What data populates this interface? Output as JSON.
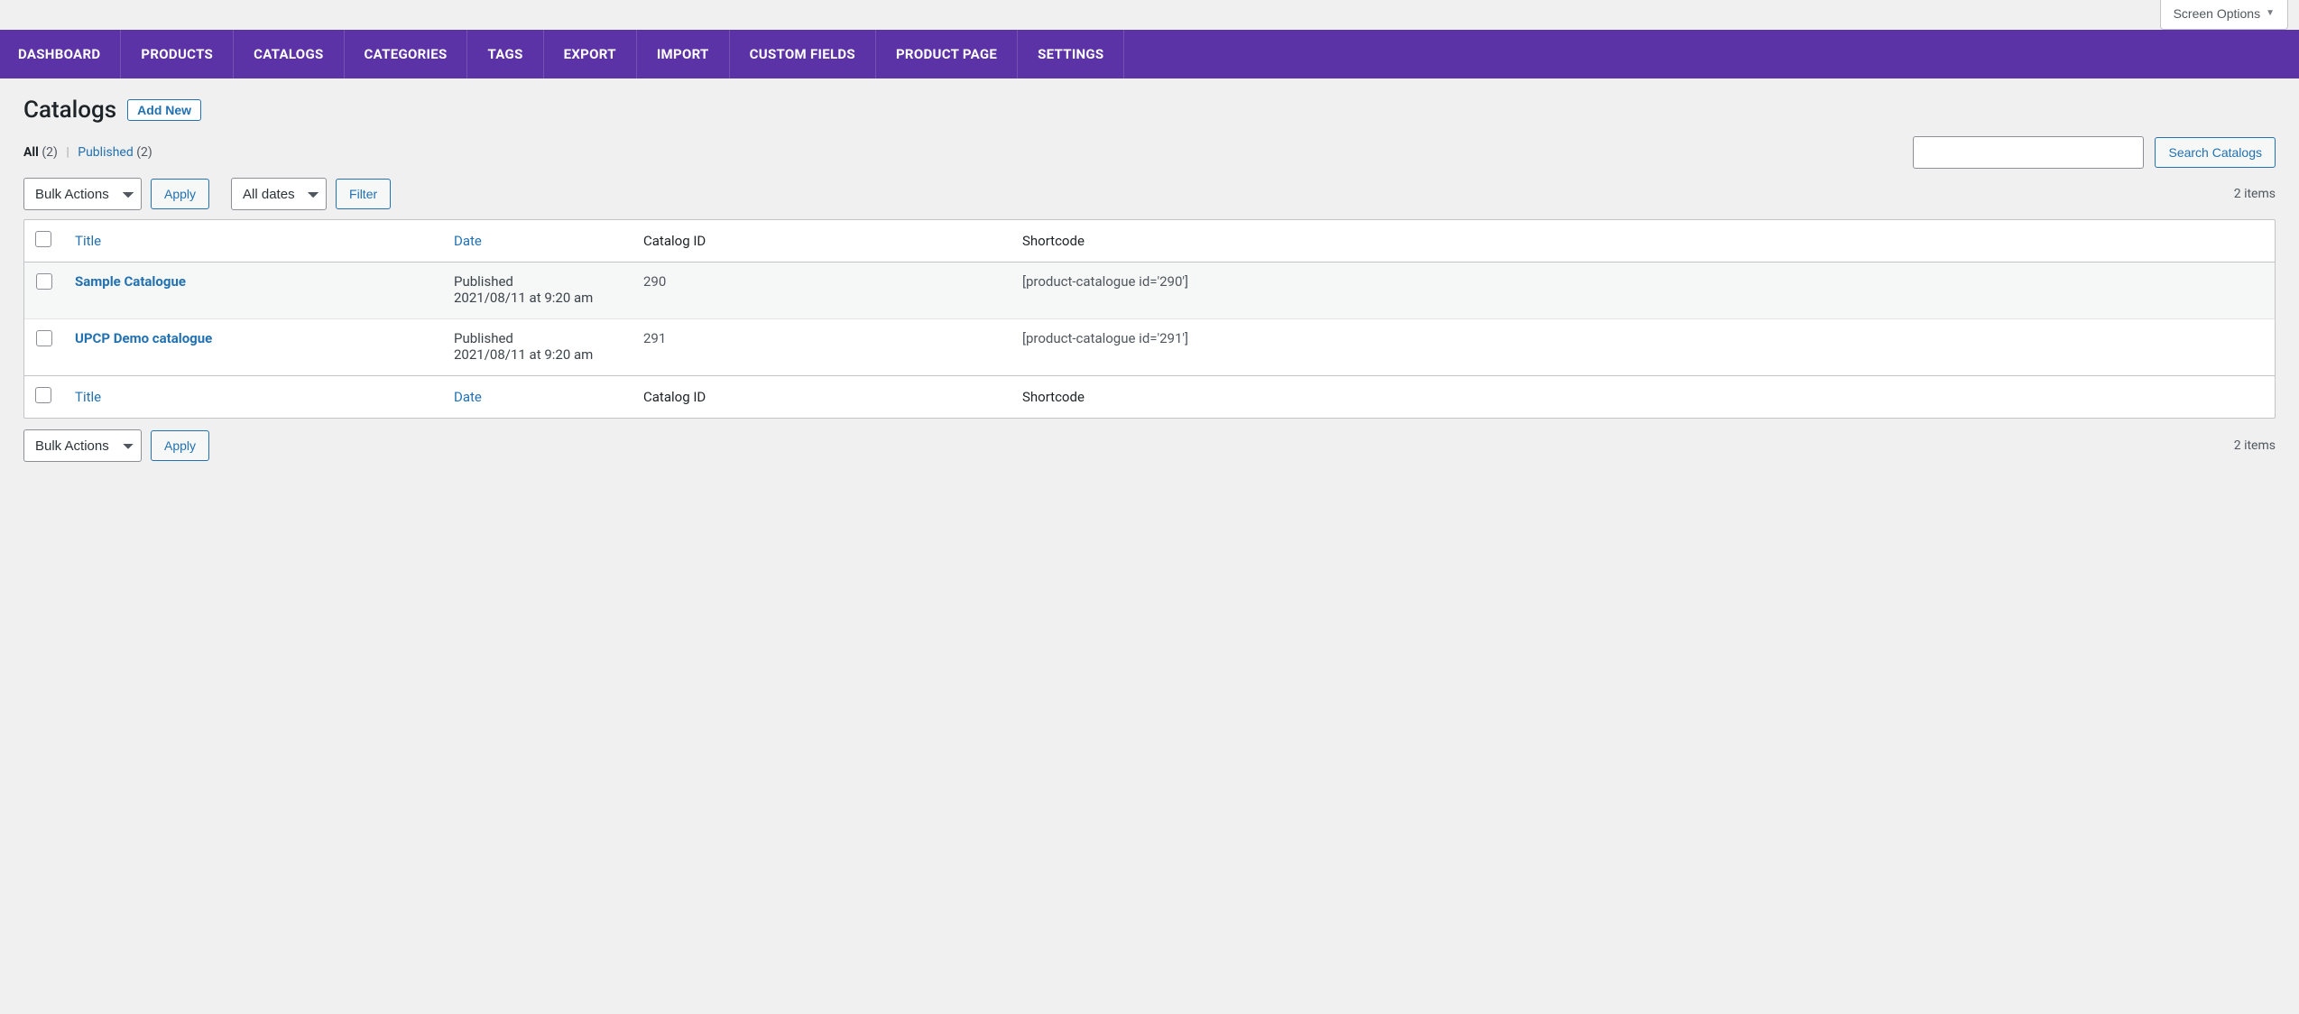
{
  "screenOptions": {
    "label": "Screen Options"
  },
  "nav": [
    "DASHBOARD",
    "PRODUCTS",
    "CATALOGS",
    "CATEGORIES",
    "TAGS",
    "EXPORT",
    "IMPORT",
    "CUSTOM FIELDS",
    "PRODUCT PAGE",
    "SETTINGS"
  ],
  "page": {
    "title": "Catalogs",
    "addNew": "Add New"
  },
  "views": {
    "allLabel": "All",
    "allCount": "(2)",
    "publishedLabel": "Published",
    "publishedCount": "(2)"
  },
  "search": {
    "buttonLabel": "Search Catalogs",
    "value": ""
  },
  "bulk": {
    "selected": "Bulk Actions",
    "applyLabel": "Apply"
  },
  "dateFilter": {
    "selected": "All dates",
    "filterLabel": "Filter"
  },
  "itemsCount": "2 items",
  "columns": {
    "title": "Title",
    "date": "Date",
    "catalogId": "Catalog ID",
    "shortcode": "Shortcode"
  },
  "rows": [
    {
      "title": "Sample Catalogue",
      "status": "Published",
      "datetime": "2021/08/11 at 9:20 am",
      "id": "290",
      "shortcode": "[product-catalogue id='290']"
    },
    {
      "title": "UPCP Demo catalogue",
      "status": "Published",
      "datetime": "2021/08/11 at 9:20 am",
      "id": "291",
      "shortcode": "[product-catalogue id='291']"
    }
  ]
}
